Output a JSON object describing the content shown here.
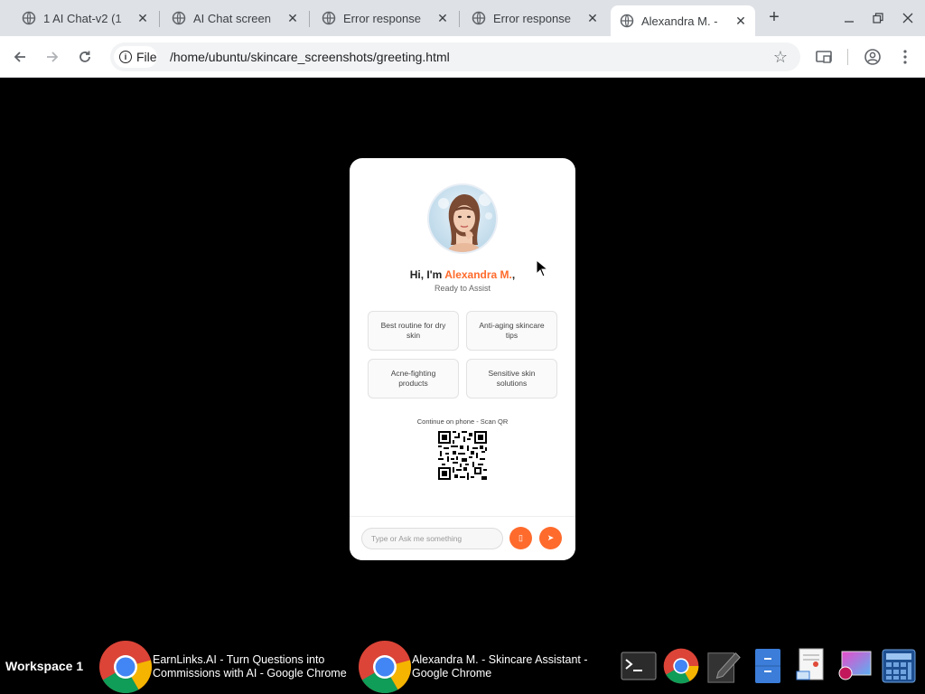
{
  "tabs": [
    {
      "title": "1 AI Chat-v2 (1",
      "active": false
    },
    {
      "title": "AI Chat screen",
      "active": false
    },
    {
      "title": "Error response",
      "active": false
    },
    {
      "title": "Error response",
      "active": false
    },
    {
      "title": "Alexandra M. -",
      "active": true
    }
  ],
  "toolbar": {
    "chip_label": "File",
    "url": "/home/ubuntu/skincare_screenshots/greeting.html"
  },
  "card": {
    "greeting_prefix": "Hi, I'm ",
    "name": "Alexandra M.",
    "greeting_suffix": ",",
    "status": "Ready to Assist",
    "suggestions": [
      "Best routine for dry skin",
      "Anti-aging skincare tips",
      "Acne-fighting products",
      "Sensitive skin solutions"
    ],
    "qr_label": "Continue on phone - Scan QR",
    "input_placeholder": "Type or Ask me something",
    "mic_label": "▯",
    "send_label": "➤"
  },
  "taskbar": {
    "workspace": "Workspace 1",
    "items": [
      "EarnLinks.AI - Turn Questions into Commissions with AI - Google Chrome",
      "Alexandra M. - Skincare Assistant - Google Chrome"
    ]
  },
  "colors": {
    "accent": "#ff6b2c",
    "tabstrip": "#dee1e6"
  }
}
